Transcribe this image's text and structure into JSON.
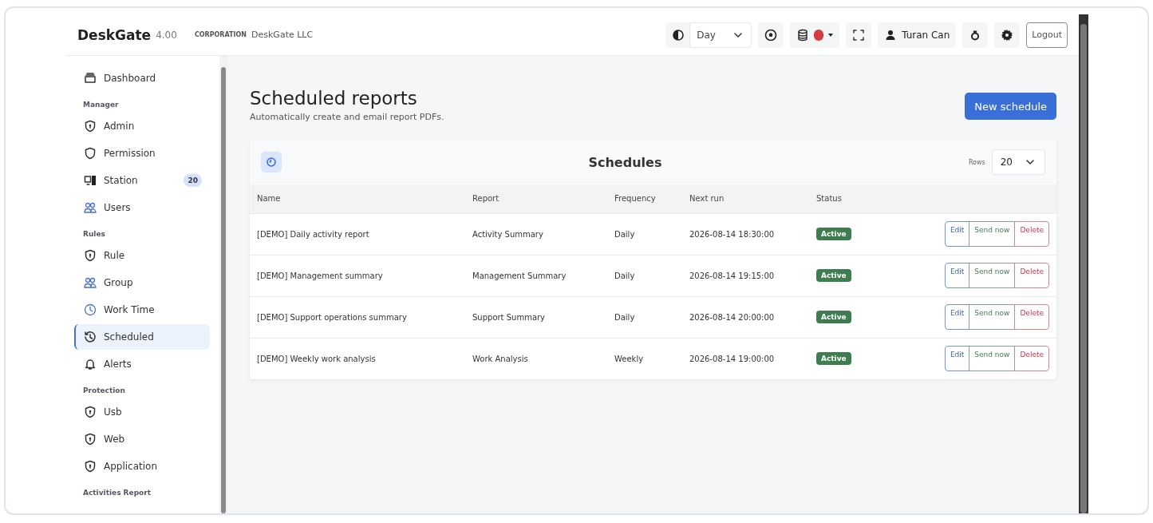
{
  "brand": {
    "name": "DeskGate",
    "version": "4.00",
    "org_label": "CORPORATION",
    "org_name": "DeskGate LLC"
  },
  "toolbar": {
    "theme_value": "Day",
    "user_name": "Turan Can",
    "logout": "Logout"
  },
  "sidebar": {
    "items": [
      {
        "kind": "item",
        "label": "Dashboard",
        "selected": false
      },
      {
        "kind": "section",
        "label": "Manager"
      },
      {
        "kind": "item",
        "label": "Admin",
        "selected": false
      },
      {
        "kind": "item",
        "label": "Permission",
        "selected": false
      },
      {
        "kind": "item",
        "label": "Station",
        "badge": "20",
        "selected": false
      },
      {
        "kind": "item",
        "label": "Users",
        "selected": false
      },
      {
        "kind": "section",
        "label": "Rules"
      },
      {
        "kind": "item",
        "label": "Rule",
        "selected": false
      },
      {
        "kind": "item",
        "label": "Group",
        "selected": false
      },
      {
        "kind": "item",
        "label": "Work Time",
        "selected": false
      },
      {
        "kind": "item",
        "label": "Scheduled",
        "selected": true
      },
      {
        "kind": "item",
        "label": "Alerts",
        "selected": false
      },
      {
        "kind": "section",
        "label": "Protection"
      },
      {
        "kind": "item",
        "label": "Usb",
        "selected": false
      },
      {
        "kind": "item",
        "label": "Web",
        "selected": false
      },
      {
        "kind": "item",
        "label": "Application",
        "selected": false
      },
      {
        "kind": "section",
        "label": "Activities Report"
      }
    ]
  },
  "page": {
    "title": "Scheduled reports",
    "subtitle": "Automatically create and email report PDFs.",
    "new_button": "New schedule"
  },
  "table": {
    "title": "Schedules",
    "rows_label": "Rows",
    "rows_value": "20",
    "columns": [
      "Name",
      "Report",
      "Frequency",
      "Next run",
      "Status"
    ],
    "rows": [
      {
        "name": "[DEMO] Daily activity report",
        "report": "Activity Summary",
        "frequency": "Daily",
        "next_run": "2026-08-14 18:30:00",
        "status": "Active",
        "actions": [
          "Edit",
          "Send now",
          "Delete"
        ]
      },
      {
        "name": "[DEMO] Management summary",
        "report": "Management Summary",
        "frequency": "Daily",
        "next_run": "2026-08-14 19:15:00",
        "status": "Active",
        "actions": [
          "Edit",
          "Send now",
          "Delete"
        ]
      },
      {
        "name": "[DEMO] Support operations summary",
        "report": "Support Summary",
        "frequency": "Daily",
        "next_run": "2026-08-14 20:00:00",
        "status": "Active",
        "actions": [
          "Edit",
          "Send now",
          "Delete"
        ]
      },
      {
        "name": "[DEMO] Weekly work analysis",
        "report": "Work Analysis",
        "frequency": "Weekly",
        "next_run": "2026-08-14 19:00:00",
        "status": "Active",
        "actions": [
          "Edit",
          "Send now",
          "Delete"
        ]
      }
    ]
  }
}
